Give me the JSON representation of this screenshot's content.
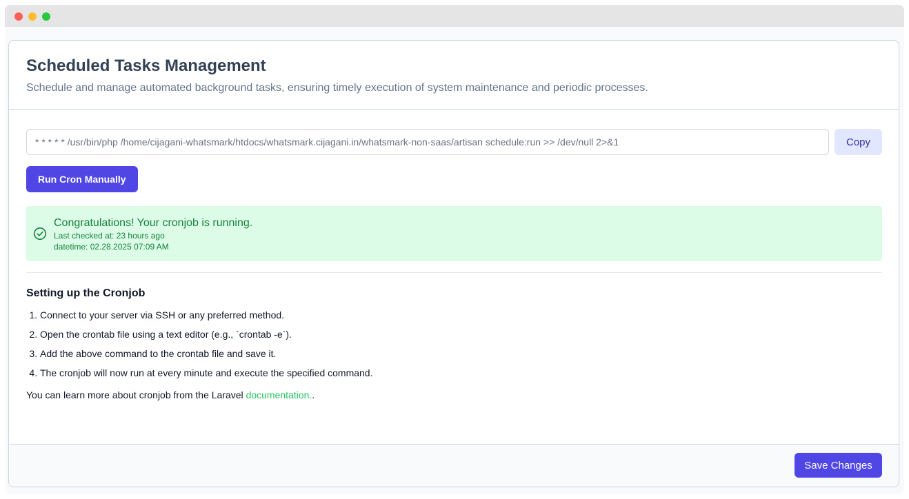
{
  "header": {
    "title": "Scheduled Tasks Management",
    "subtitle": "Schedule and manage automated background tasks, ensuring timely execution of system maintenance and periodic processes."
  },
  "command": {
    "value": "* * * * * /usr/bin/php /home/cijagani-whatsmark/htdocs/whatsmark.cijagani.in/whatsmark-non-saas/artisan schedule:run >> /dev/null 2>&1",
    "copy_label": "Copy"
  },
  "run_button": {
    "label": "Run Cron Manually"
  },
  "status": {
    "title": "Congratulations! Your cronjob is running.",
    "last_checked": "Last checked at: 23 hours ago",
    "datetime": "datetime: 02.28.2025 07:09 AM",
    "icon": "check-circle-icon",
    "color": "#15803d"
  },
  "setup": {
    "title": "Setting up the Cronjob",
    "steps": [
      "Connect to your server via SSH or any preferred method.",
      "Open the crontab file using a text editor (e.g., `crontab -e`).",
      "Add the above command to the crontab file and save it.",
      "The cronjob will now run at every minute and execute the specified command."
    ],
    "learn_prefix": "You can learn more about cronjob from the Laravel ",
    "learn_link": "documentation.",
    "learn_suffix": "."
  },
  "footer": {
    "save_label": "Save Changes"
  },
  "colors": {
    "primary": "#4f46e5",
    "success_bg": "#dcfce7",
    "link": "#22c55e"
  }
}
